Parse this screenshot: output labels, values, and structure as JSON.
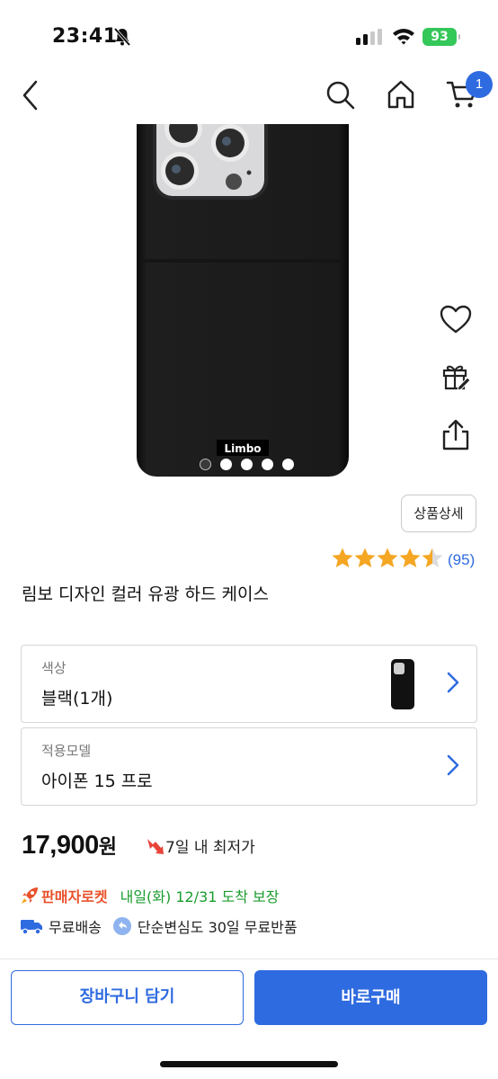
{
  "status_bar": {
    "time": "23:41",
    "battery": "93"
  },
  "nav": {
    "cart_count": "1"
  },
  "product": {
    "image_brand_text": "Limbo",
    "image_count": 5,
    "active_image_index": 0,
    "detail_button_label": "상품상세",
    "rating_value": 4.5,
    "rating_max": 5,
    "review_count": "(95)",
    "title": "림보 디자인 컬러 유광 하드 케이스"
  },
  "options": [
    {
      "label": "색상",
      "value": "블랙(1개)"
    },
    {
      "label": "적용모델",
      "value": "아이폰 15 프로"
    }
  ],
  "price": {
    "amount": "17,900",
    "unit": "원",
    "lowest_badge": "7일 내 최저가"
  },
  "delivery": {
    "rocket_label": "판매자로켓",
    "arrival_text": "내일(화) 12/31 도착 보장"
  },
  "benefits": {
    "free_shipping": "무료배송",
    "free_return": "단순변심도 30일 무료반품"
  },
  "actions": {
    "cart_button": "장바구니 담기",
    "buy_button": "바로구매"
  },
  "colors": {
    "accent": "#2f6be0",
    "star": "#f5a623",
    "rocket": "#e8512b",
    "arrival": "#1a9c2e",
    "battery": "#34c759"
  }
}
